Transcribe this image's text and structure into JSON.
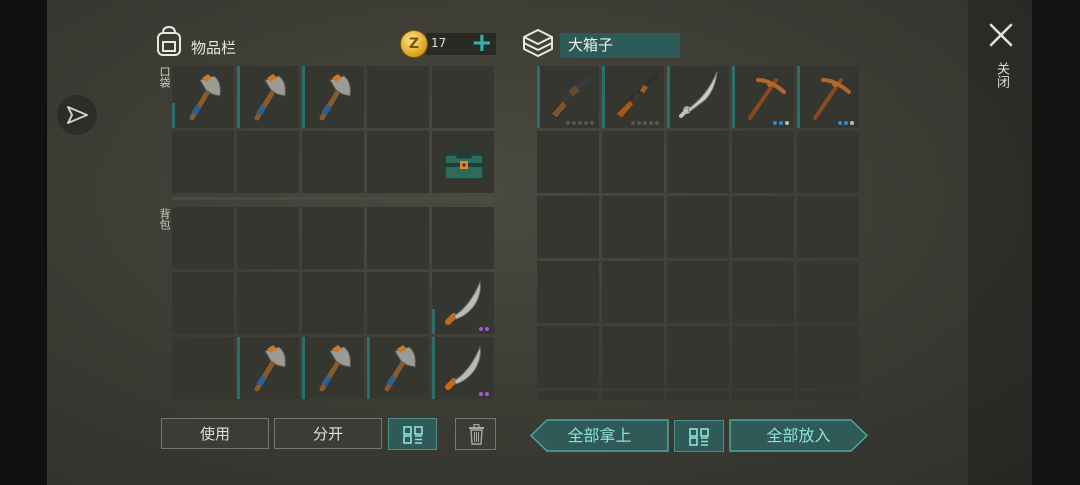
{
  "inventory": {
    "title": "物品栏",
    "coins": "17",
    "plus": "+"
  },
  "container": {
    "title": "大箱子"
  },
  "labels": {
    "pocket": "口袋",
    "backpack": "背包"
  },
  "buttons": {
    "use": "使用",
    "split": "分开",
    "take_all": "全部拿上",
    "put_all": "全部放入"
  },
  "close": {
    "label": "关闭",
    "icon": "close-icon"
  },
  "colors": {
    "accent": "#34b3a8",
    "panel_teal": "#2d5b57",
    "slot": "#363631"
  },
  "pocket_slots": [
    {
      "item": "hatchet",
      "accent": "teal-short"
    },
    {
      "item": "hatchet",
      "accent": "teal"
    },
    {
      "item": "hatchet",
      "accent": "teal"
    },
    {
      "item": "",
      "accent": ""
    },
    {
      "item": "",
      "accent": ""
    },
    {
      "item": "",
      "accent": ""
    },
    {
      "item": "",
      "accent": ""
    },
    {
      "item": "",
      "accent": ""
    },
    {
      "item": "",
      "accent": ""
    },
    {
      "item": "toolbox",
      "accent": ""
    }
  ],
  "backpack_slots": [
    {
      "item": "",
      "accent": ""
    },
    {
      "item": "",
      "accent": ""
    },
    {
      "item": "",
      "accent": ""
    },
    {
      "item": "",
      "accent": ""
    },
    {
      "item": "",
      "accent": ""
    },
    {
      "item": "",
      "accent": ""
    },
    {
      "item": "",
      "accent": ""
    },
    {
      "item": "",
      "accent": ""
    },
    {
      "item": "",
      "accent": ""
    },
    {
      "item": "machete",
      "accent": "teal-short",
      "dots": [
        "purple",
        "purple"
      ]
    },
    {
      "item": "",
      "accent": ""
    },
    {
      "item": "hatchet",
      "accent": "teal"
    },
    {
      "item": "hatchet",
      "accent": "teal"
    },
    {
      "item": "hatchet",
      "accent": "teal"
    },
    {
      "item": "machete",
      "accent": "teal",
      "dots": [
        "purple",
        "purple"
      ]
    }
  ],
  "chest_slots": [
    {
      "item": "shotgun",
      "accent": "teal",
      "dots": [
        "gray",
        "gray",
        "gray",
        "gray",
        "gray"
      ]
    },
    {
      "item": "rifle",
      "accent": "teal",
      "dots": [
        "gray",
        "gray",
        "gray",
        "gray",
        "gray"
      ]
    },
    {
      "item": "sword",
      "accent": "teal"
    },
    {
      "item": "pickaxe",
      "accent": "teal",
      "dots": [
        "blue",
        "blue",
        "white"
      ]
    },
    {
      "item": "pickaxe",
      "accent": "teal",
      "dots": [
        "blue",
        "blue",
        "white"
      ]
    },
    {
      "item": ""
    },
    {
      "item": ""
    },
    {
      "item": ""
    },
    {
      "item": ""
    },
    {
      "item": ""
    },
    {
      "item": ""
    },
    {
      "item": ""
    },
    {
      "item": ""
    },
    {
      "item": ""
    },
    {
      "item": ""
    },
    {
      "item": ""
    },
    {
      "item": ""
    },
    {
      "item": ""
    },
    {
      "item": ""
    },
    {
      "item": ""
    },
    {
      "item": ""
    },
    {
      "item": ""
    },
    {
      "item": ""
    },
    {
      "item": ""
    },
    {
      "item": ""
    },
    {
      "item": ""
    },
    {
      "item": ""
    },
    {
      "item": ""
    },
    {
      "item": ""
    },
    {
      "item": ""
    }
  ]
}
